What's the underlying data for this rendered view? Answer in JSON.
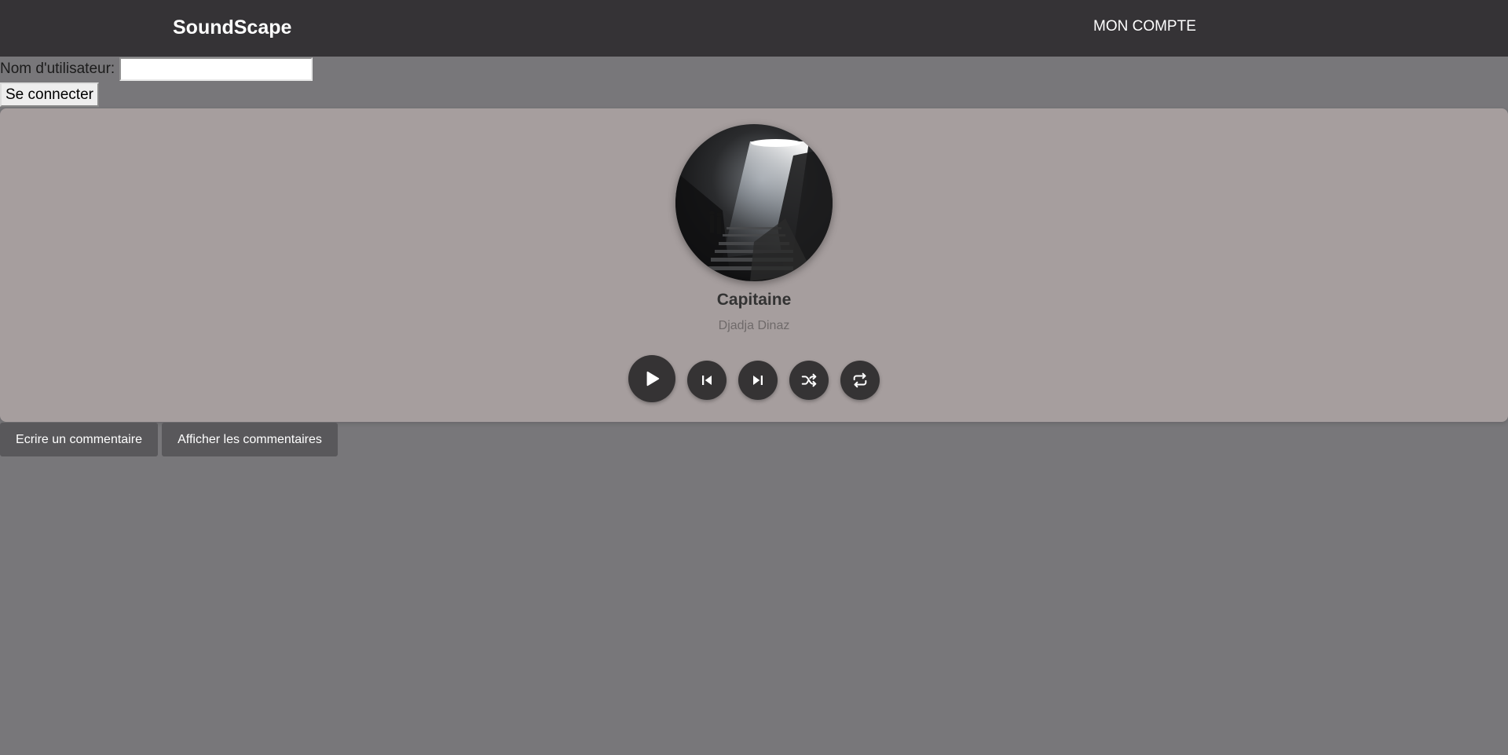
{
  "header": {
    "brand": "SoundScape",
    "account_link": "MON COMPTE"
  },
  "login": {
    "username_label": "Nom d'utilisateur:",
    "username_value": "",
    "connect_label": "Se connecter"
  },
  "player": {
    "title": "Capitaine",
    "artist": "Djadja Dinaz",
    "controls": {
      "play": "play-icon",
      "previous": "skip-back-icon",
      "next": "skip-forward-icon",
      "shuffle": "shuffle-icon",
      "repeat": "repeat-icon"
    }
  },
  "comments": {
    "write_label": "Ecrire un commentaire",
    "show_label": "Afficher les commentaires"
  },
  "colors": {
    "header_bg": "#353336",
    "page_bg": "#78777a",
    "player_bg": "#a69e9e",
    "control_bg": "#353334",
    "comment_button_bg": "#59585b"
  }
}
